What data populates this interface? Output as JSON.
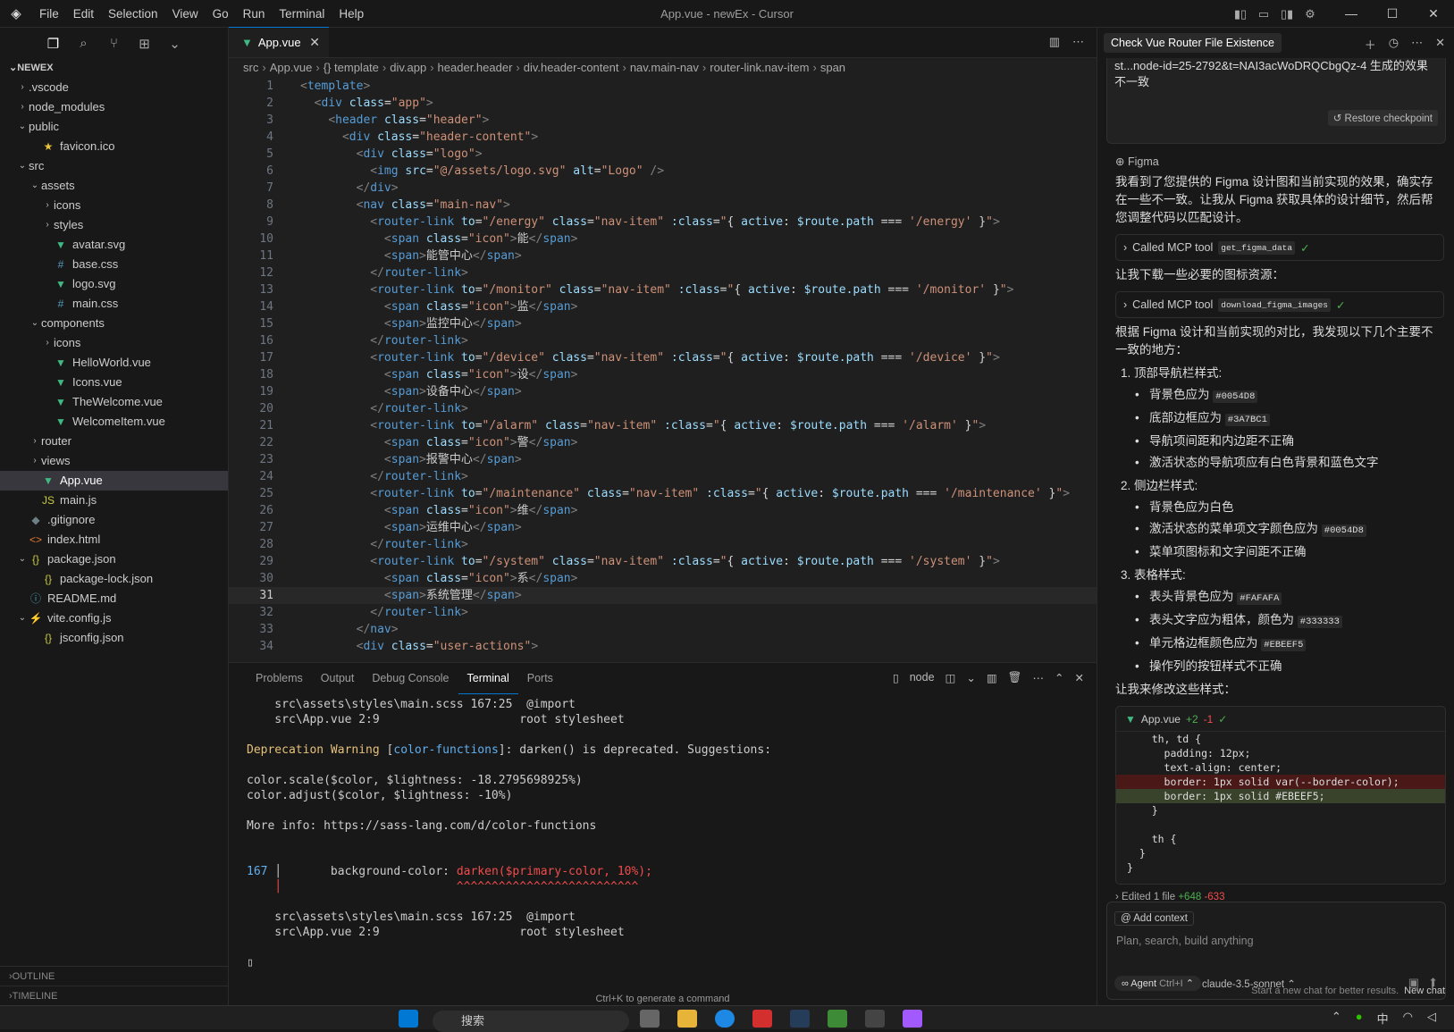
{
  "window": {
    "title": "App.vue - newEx - Cursor"
  },
  "menu": [
    "File",
    "Edit",
    "Selection",
    "View",
    "Go",
    "Run",
    "Terminal",
    "Help"
  ],
  "explorer": {
    "root": "NEWEX",
    "items": [
      {
        "label": ".vscode",
        "depth": 0,
        "type": "folder",
        "open": false
      },
      {
        "label": "node_modules",
        "depth": 0,
        "type": "folder",
        "open": false
      },
      {
        "label": "public",
        "depth": 0,
        "type": "folder",
        "open": true
      },
      {
        "label": "favicon.ico",
        "depth": 1,
        "type": "star"
      },
      {
        "label": "src",
        "depth": 0,
        "type": "folder",
        "open": true
      },
      {
        "label": "assets",
        "depth": 1,
        "type": "folder",
        "open": true
      },
      {
        "label": "icons",
        "depth": 2,
        "type": "folder",
        "open": false
      },
      {
        "label": "styles",
        "depth": 2,
        "type": "folder",
        "open": false
      },
      {
        "label": "avatar.svg",
        "depth": 2,
        "type": "svg"
      },
      {
        "label": "base.css",
        "depth": 2,
        "type": "css"
      },
      {
        "label": "logo.svg",
        "depth": 2,
        "type": "svg"
      },
      {
        "label": "main.css",
        "depth": 2,
        "type": "css"
      },
      {
        "label": "components",
        "depth": 1,
        "type": "folder",
        "open": true
      },
      {
        "label": "icons",
        "depth": 2,
        "type": "folder",
        "open": false
      },
      {
        "label": "HelloWorld.vue",
        "depth": 2,
        "type": "vue"
      },
      {
        "label": "Icons.vue",
        "depth": 2,
        "type": "vue"
      },
      {
        "label": "TheWelcome.vue",
        "depth": 2,
        "type": "vue"
      },
      {
        "label": "WelcomeItem.vue",
        "depth": 2,
        "type": "vue"
      },
      {
        "label": "router",
        "depth": 1,
        "type": "folder",
        "open": false
      },
      {
        "label": "views",
        "depth": 1,
        "type": "folder",
        "open": false
      },
      {
        "label": "App.vue",
        "depth": 1,
        "type": "vue",
        "selected": true
      },
      {
        "label": "main.js",
        "depth": 1,
        "type": "js"
      },
      {
        "label": ".gitignore",
        "depth": 0,
        "type": "git"
      },
      {
        "label": "index.html",
        "depth": 0,
        "type": "html"
      },
      {
        "label": "package.json",
        "depth": 0,
        "type": "jsonopen"
      },
      {
        "label": "package-lock.json",
        "depth": 1,
        "type": "json"
      },
      {
        "label": "README.md",
        "depth": 0,
        "type": "md"
      },
      {
        "label": "vite.config.js",
        "depth": 0,
        "type": "vite"
      },
      {
        "label": "jsconfig.json",
        "depth": 1,
        "type": "json"
      }
    ],
    "outline": "OUTLINE",
    "timeline": "TIMELINE"
  },
  "editor": {
    "tab": "App.vue",
    "breadcrumbs": [
      "src",
      "App.vue",
      "{} template",
      "div.app",
      "header.header",
      "div.header-content",
      "nav.main-nav",
      "router-link.nav-item",
      "span"
    ],
    "current_line": 31,
    "lines": [
      "<template>",
      "  <div class=\"app\">",
      "    <header class=\"header\">",
      "      <div class=\"header-content\">",
      "        <div class=\"logo\">",
      "          <img src=\"@/assets/logo.svg\" alt=\"Logo\" />",
      "        </div>",
      "        <nav class=\"main-nav\">",
      "          <router-link to=\"/energy\" class=\"nav-item\" :class=\"{ active: $route.path === '/energy' }\">",
      "            <span class=\"icon\">能</span>",
      "            <span>能管中心</span>",
      "          </router-link>",
      "          <router-link to=\"/monitor\" class=\"nav-item\" :class=\"{ active: $route.path === '/monitor' }\">",
      "            <span class=\"icon\">监</span>",
      "            <span>监控中心</span>",
      "          </router-link>",
      "          <router-link to=\"/device\" class=\"nav-item\" :class=\"{ active: $route.path === '/device' }\">",
      "            <span class=\"icon\">设</span>",
      "            <span>设备中心</span>",
      "          </router-link>",
      "          <router-link to=\"/alarm\" class=\"nav-item\" :class=\"{ active: $route.path === '/alarm' }\">",
      "            <span class=\"icon\">警</span>",
      "            <span>报警中心</span>",
      "          </router-link>",
      "          <router-link to=\"/maintenance\" class=\"nav-item\" :class=\"{ active: $route.path === '/maintenance' }\">",
      "            <span class=\"icon\">维</span>",
      "            <span>运维中心</span>",
      "          </router-link>",
      "          <router-link to=\"/system\" class=\"nav-item\" :class=\"{ active: $route.path === '/system' }\">",
      "            <span class=\"icon\">系</span>",
      "            <span>系统管理</span>",
      "          </router-link>",
      "        </nav>",
      "        <div class=\"user-actions\">"
    ]
  },
  "panel": {
    "tabs": [
      "Problems",
      "Output",
      "Debug Console",
      "Terminal",
      "Ports"
    ],
    "active": "Terminal",
    "shell": "node",
    "terminal": [
      {
        "t": "    src\\assets\\styles\\main.scss 167:25  @import",
        "c": ""
      },
      {
        "t": "    src\\App.vue 2:9                    root stylesheet",
        "c": ""
      },
      {
        "t": "",
        "c": ""
      },
      {
        "t": "Deprecation Warning [color-functions]: darken() is deprecated. Suggestions:",
        "c": "warn"
      },
      {
        "t": "",
        "c": ""
      },
      {
        "t": "color.scale($color, $lightness: -18.2795698925%)",
        "c": ""
      },
      {
        "t": "color.adjust($color, $lightness: -10%)",
        "c": ""
      },
      {
        "t": "",
        "c": ""
      },
      {
        "t": "More info: https://sass-lang.com/d/color-functions",
        "c": ""
      },
      {
        "t": "",
        "c": ""
      },
      {
        "t": "",
        "c": ""
      },
      {
        "t": "167 │       background-color: darken($primary-color, 10%);",
        "c": "code"
      },
      {
        "t": "    │                         ^^^^^^^^^^^^^^^^^^^^^^^^^^",
        "c": "red"
      },
      {
        "t": "",
        "c": ""
      },
      {
        "t": "    src\\assets\\styles\\main.scss 167:25  @import",
        "c": ""
      },
      {
        "t": "    src\\App.vue 2:9                    root stylesheet",
        "c": ""
      },
      {
        "t": "",
        "c": ""
      },
      {
        "t": "▯",
        "c": ""
      }
    ],
    "hint": "Ctrl+K to generate a command"
  },
  "chat": {
    "tab_title": "Check Vue Router File Existence",
    "user_msg_tail": "st...node-id=25-2792&t=NAI3acWoDRQCbgQz-4 生成的效果不一致",
    "restore": "Restore checkpoint",
    "figma_label": "Figma",
    "intro": "我看到了您提供的 Figma 设计图和当前实现的效果，确实存在一些不一致。让我从 Figma 获取具体的设计细节，然后帮您调整代码以匹配设计。",
    "tool1": {
      "label": "Called MCP tool",
      "name": "get_figma_data"
    },
    "mid": "让我下载一些必要的图标资源：",
    "tool2": {
      "label": "Called MCP tool",
      "name": "download_figma_images"
    },
    "compare": "根据 Figma 设计和当前实现的对比，我发现以下几个主要不一致的地方：",
    "sections": [
      {
        "title": "1. 顶部导航栏样式:",
        "items": [
          {
            "text": "背景色应为 ",
            "code": "#0054D8"
          },
          {
            "text": "底部边框应为 ",
            "code": "#3A7BC1"
          },
          {
            "text": "导航项间距和内边距不正确",
            "code": ""
          },
          {
            "text": "激活状态的导航项应有白色背景和蓝色文字",
            "code": ""
          }
        ]
      },
      {
        "title": "2. 侧边栏样式:",
        "items": [
          {
            "text": "背景色应为白色",
            "code": ""
          },
          {
            "text": "激活状态的菜单项文字颜色应为 ",
            "code": "#0054D8"
          },
          {
            "text": "菜单项图标和文字间距不正确",
            "code": ""
          }
        ]
      },
      {
        "title": "3. 表格样式:",
        "items": [
          {
            "text": "表头背景色应为 ",
            "code": "#FAFAFA"
          },
          {
            "text": "表头文字应为粗体，颜色为 ",
            "code": "#333333"
          },
          {
            "text": "单元格边框颜色应为 ",
            "code": "#EBEEF5"
          },
          {
            "text": "操作列的按钮样式不正确",
            "code": ""
          }
        ]
      }
    ],
    "fix": "让我来修改这些样式：",
    "diff": {
      "file": "App.vue",
      "added": "+2",
      "removed": "-1",
      "lines": [
        {
          "t": "    th, td {",
          "k": ""
        },
        {
          "t": "      padding: 12px;",
          "k": ""
        },
        {
          "t": "      text-align: center;",
          "k": ""
        },
        {
          "t": "      border: 1px solid var(--border-color);",
          "k": "del"
        },
        {
          "t": "      border: 1px solid #EBEEF5;",
          "k": "add"
        },
        {
          "t": "    }",
          "k": ""
        },
        {
          "t": "",
          "k": ""
        },
        {
          "t": "    th {",
          "k": ""
        },
        {
          "t": "  }",
          "k": ""
        },
        {
          "t": "}",
          "k": ""
        }
      ]
    },
    "edited": {
      "label": "Edited 1 file",
      "add": "+648",
      "del": "-633"
    },
    "add_context": "Add context",
    "placeholder": "Plan, search, build anything",
    "agent": "Agent",
    "agent_kbd": "Ctrl+I",
    "model": "claude-3.5-sonnet",
    "footer_hint": "Start a new chat for better results.",
    "new_chat": "New chat"
  },
  "taskbar": {
    "search": "搜索",
    "lang": "中"
  }
}
